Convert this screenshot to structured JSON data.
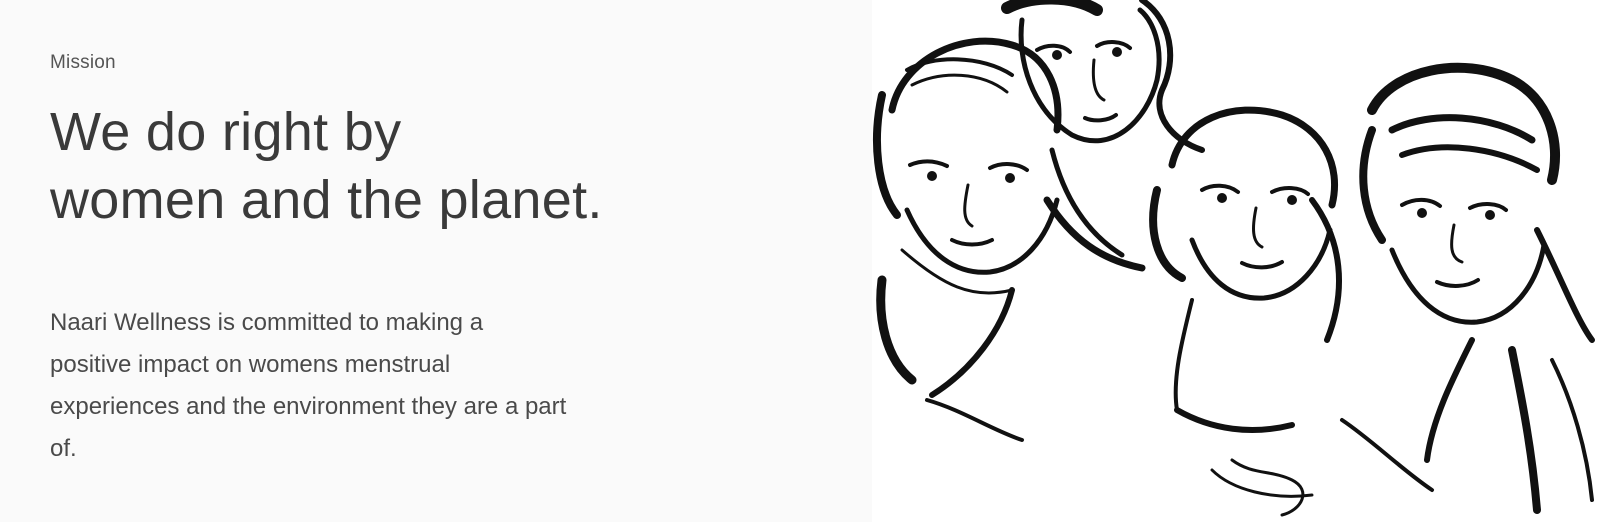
{
  "mission": {
    "eyebrow": "Mission",
    "headline_lines": [
      "We do right by",
      "women and the planet."
    ],
    "body_lines": [
      "Naari Wellness is committed to making a",
      "positive impact on womens menstrual",
      "experiences and the environment they are a part",
      "of."
    ]
  },
  "illustration": {
    "icon": "women-group-sketch-illustration",
    "ink_color": "#111111",
    "paper_color": "#ffffff"
  },
  "colors": {
    "text_primary": "#3a3a3a",
    "text_body": "#4a4a4a",
    "text_eyebrow": "#555555",
    "section_background": "#fafafa"
  }
}
